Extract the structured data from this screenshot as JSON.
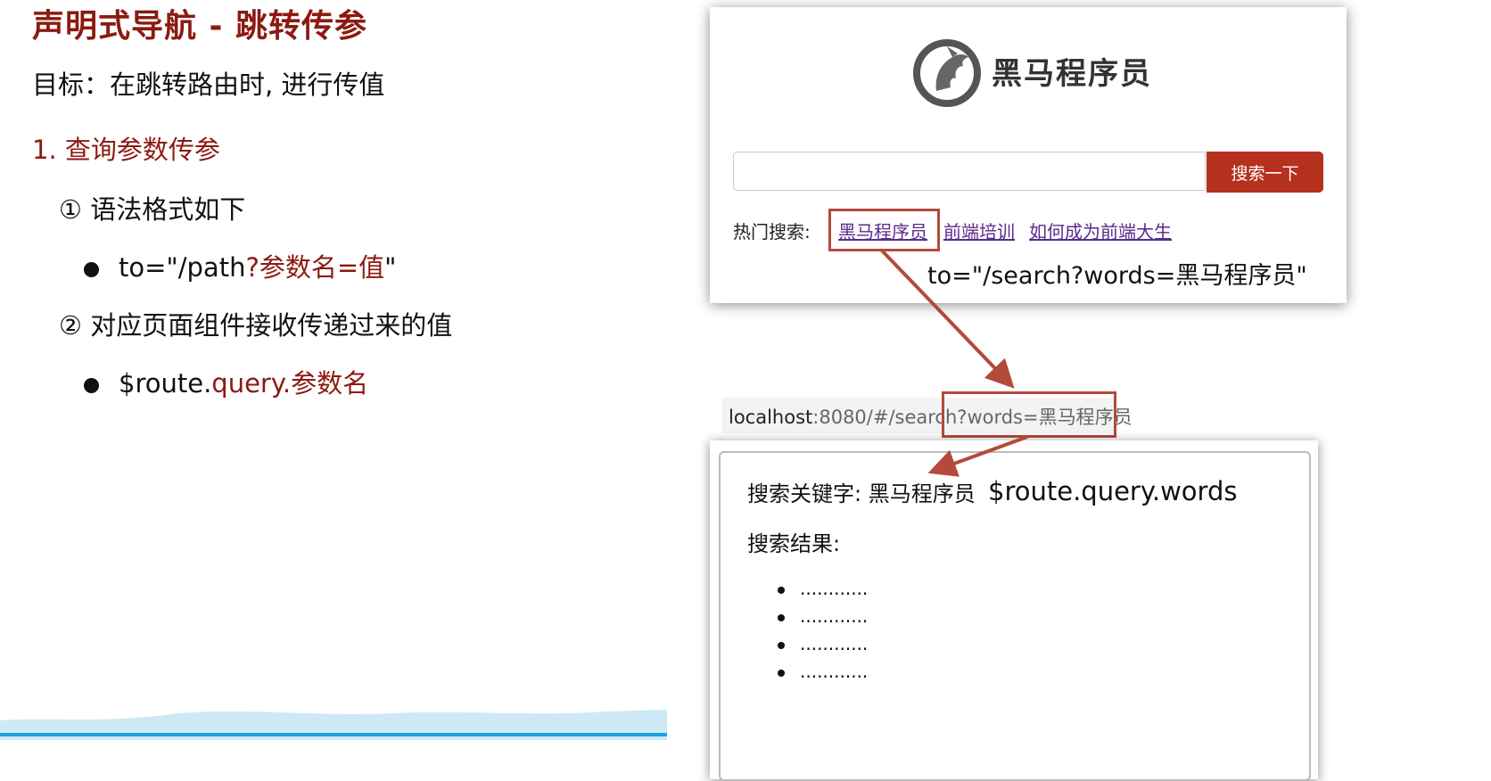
{
  "slide": {
    "title": "声明式导航 - 跳转传参",
    "goal": "目标：在跳转路由时, 进行传值",
    "section1": "1.  查询参数传参",
    "step1": "① 语法格式如下",
    "syntax_prefix": "to=\"/path",
    "syntax_highlight": "?参数名=值",
    "syntax_suffix": "\"",
    "step2": "② 对应页面组件接收传递过来的值",
    "receive_prefix": "$route.",
    "receive_highlight": "query.参数名"
  },
  "search_page": {
    "logo_text": "黑马程序员",
    "search_button": "搜索一下",
    "search_value": "",
    "hot_label": "热门搜索:",
    "hot_links": [
      "黑马程序员",
      "前端培训",
      "如何成为前端大生"
    ],
    "to_annotation": "to=\"/search?words=黑马程序员\""
  },
  "url_bar": {
    "host": "localhost",
    "path": ":8080/#/search",
    "query": "?words=黑马程序员"
  },
  "result_page": {
    "keyword_label": "搜索关键字: 黑马程序员",
    "route_annotation": "$route.query.words",
    "results_label": "搜索结果:",
    "results": [
      "............",
      "............",
      "............",
      "............"
    ]
  },
  "colors": {
    "title": "#8b1a10",
    "highlight": "#8b1a10",
    "button": "#b5301d",
    "arrow": "#b34a3c",
    "link": "#5b2a8c"
  }
}
